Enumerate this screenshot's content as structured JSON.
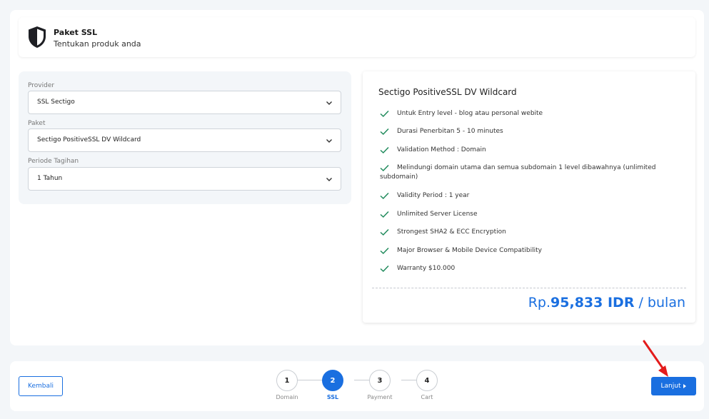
{
  "header": {
    "title": "Paket SSL",
    "subtitle": "Tentukan produk anda",
    "icon": "shield-icon"
  },
  "form": {
    "provider": {
      "label": "Provider",
      "value": "SSL Sectigo"
    },
    "paket": {
      "label": "Paket",
      "value": "Sectigo PositiveSSL DV Wildcard"
    },
    "periode": {
      "label": "Periode Tagihan",
      "value": "1 Tahun"
    }
  },
  "product": {
    "name": "Sectigo PositiveSSL DV Wildcard",
    "features": [
      "Untuk Entry level - blog atau personal webite",
      "Durasi Penerbitan 5 - 10 minutes",
      "Validation Method : Domain",
      "Melindungi domain utama dan semua subdomain 1 level dibawahnya (unlimited subdomain)",
      "Validity Period : 1 year",
      "Unlimited Server License",
      "Strongest SHA2 & ECC Encryption",
      "Major Browser & Mobile Device Compatibility",
      "Warranty $10.000"
    ],
    "price_prefix": "Rp.",
    "price_amount": "95,833 IDR",
    "price_suffix": " / bulan"
  },
  "footer": {
    "back_label": "Kembali",
    "next_label": "Lanjut",
    "steps": [
      {
        "number": "1",
        "label": "Domain",
        "active": false
      },
      {
        "number": "2",
        "label": "SSL",
        "active": true
      },
      {
        "number": "3",
        "label": "Payment",
        "active": false
      },
      {
        "number": "4",
        "label": "Cart",
        "active": false
      }
    ]
  },
  "colors": {
    "accent": "#1a6fe0",
    "check": "#1f8a5b",
    "annotation_arrow": "#e31b1b"
  }
}
